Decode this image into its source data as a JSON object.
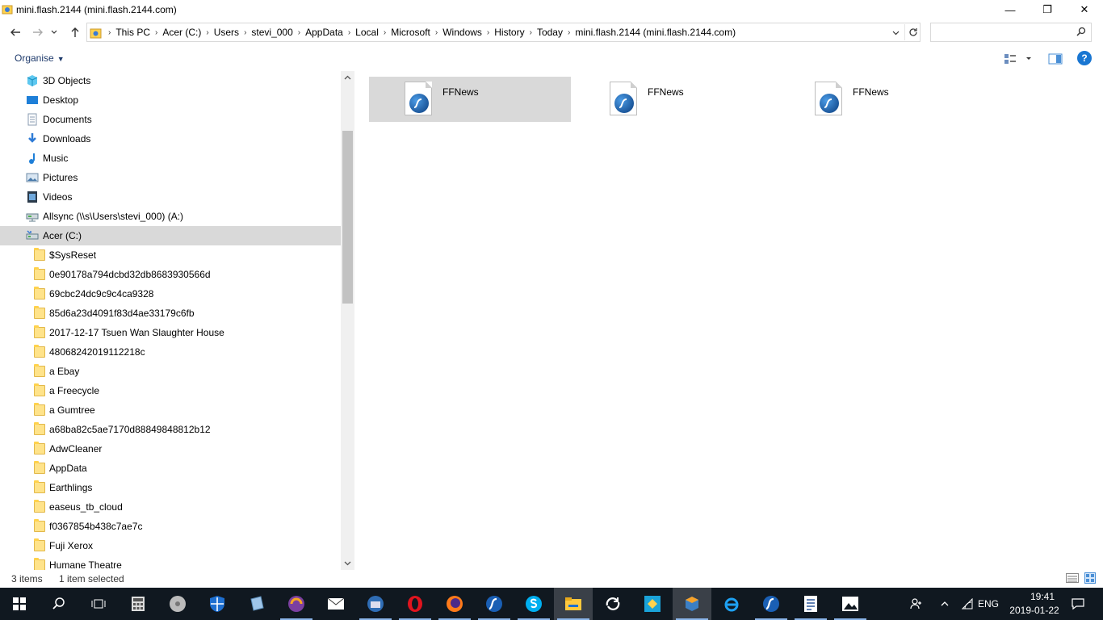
{
  "window": {
    "title": "mini.flash.2144 (mini.flash.2144.com)",
    "minimize_glyph": "—",
    "restore_glyph": "❐",
    "close_glyph": "✕"
  },
  "address": {
    "crumbs": [
      "This PC",
      "Acer (C:)",
      "Users",
      "stevi_000",
      "AppData",
      "Local",
      "Microsoft",
      "Windows",
      "History",
      "Today",
      "mini.flash.2144 (mini.flash.2144.com)"
    ],
    "search_placeholder": ""
  },
  "toolbar": {
    "organise_label": "Organise",
    "help_label": "?"
  },
  "nav": {
    "items": [
      {
        "label": "3D Objects",
        "icon": "3d-objects-icon",
        "level": 1
      },
      {
        "label": "Desktop",
        "icon": "desktop-icon",
        "level": 1
      },
      {
        "label": "Documents",
        "icon": "documents-icon",
        "level": 1
      },
      {
        "label": "Downloads",
        "icon": "downloads-icon",
        "level": 1
      },
      {
        "label": "Music",
        "icon": "music-icon",
        "level": 1
      },
      {
        "label": "Pictures",
        "icon": "pictures-icon",
        "level": 1
      },
      {
        "label": "Videos",
        "icon": "videos-icon",
        "level": 1
      },
      {
        "label": "Allsync (\\\\s\\Users\\stevi_000) (A:)",
        "icon": "network-drive-icon",
        "level": 1
      },
      {
        "label": "Acer (C:)",
        "icon": "local-disk-icon",
        "level": 1,
        "selected": true
      },
      {
        "label": "$SysReset",
        "icon": "folder-icon",
        "level": 2
      },
      {
        "label": "0e90178a794dcbd32db8683930566d",
        "icon": "folder-icon",
        "level": 2
      },
      {
        "label": "69cbc24dc9c9c4ca9328",
        "icon": "folder-icon",
        "level": 2
      },
      {
        "label": "85d6a23d4091f83d4ae33179c6fb",
        "icon": "folder-icon",
        "level": 2
      },
      {
        "label": "2017-12-17 Tsuen Wan Slaughter House",
        "icon": "folder-icon",
        "level": 2
      },
      {
        "label": "48068242019112218c",
        "icon": "folder-icon",
        "level": 2
      },
      {
        "label": "a Ebay",
        "icon": "folder-icon",
        "level": 2
      },
      {
        "label": "a Freecycle",
        "icon": "folder-icon",
        "level": 2
      },
      {
        "label": "a Gumtree",
        "icon": "folder-icon",
        "level": 2
      },
      {
        "label": "a68ba82c5ae7170d88849848812b12",
        "icon": "folder-icon",
        "level": 2
      },
      {
        "label": "AdwCleaner",
        "icon": "folder-icon",
        "level": 2
      },
      {
        "label": "AppData",
        "icon": "folder-icon",
        "level": 2
      },
      {
        "label": "Earthlings",
        "icon": "folder-icon",
        "level": 2
      },
      {
        "label": "easeus_tb_cloud",
        "icon": "folder-icon",
        "level": 2
      },
      {
        "label": "f0367854b438c7ae7c",
        "icon": "folder-icon",
        "level": 2
      },
      {
        "label": "Fuji Xerox",
        "icon": "folder-icon",
        "level": 2
      },
      {
        "label": "Humane Theatre",
        "icon": "folder-icon",
        "level": 2
      }
    ]
  },
  "files": [
    {
      "name": "FFNews",
      "selected": true
    },
    {
      "name": "FFNews",
      "selected": false
    },
    {
      "name": "FFNews",
      "selected": false
    }
  ],
  "status": {
    "count": "3 items",
    "selection": "1 item selected"
  },
  "taskbar": {
    "apps": [
      "start-icon",
      "search-icon",
      "task-view-icon",
      "calculator-icon",
      "media-player-icon",
      "security-shield-icon",
      "notepad-icon",
      "browser-swirl-icon",
      "mail-icon",
      "thunderbird-icon",
      "opera-icon",
      "firefox-icon",
      "quickplay-icon",
      "skype-icon",
      "file-explorer-icon",
      "sync-icon",
      "app-tile-icon",
      "virtualbox-icon",
      "internet-explorer-icon",
      "flash-player-icon",
      "wordpad-icon",
      "photos-icon"
    ],
    "language": "ENG",
    "time": "19:41",
    "date": "2019-01-22"
  }
}
